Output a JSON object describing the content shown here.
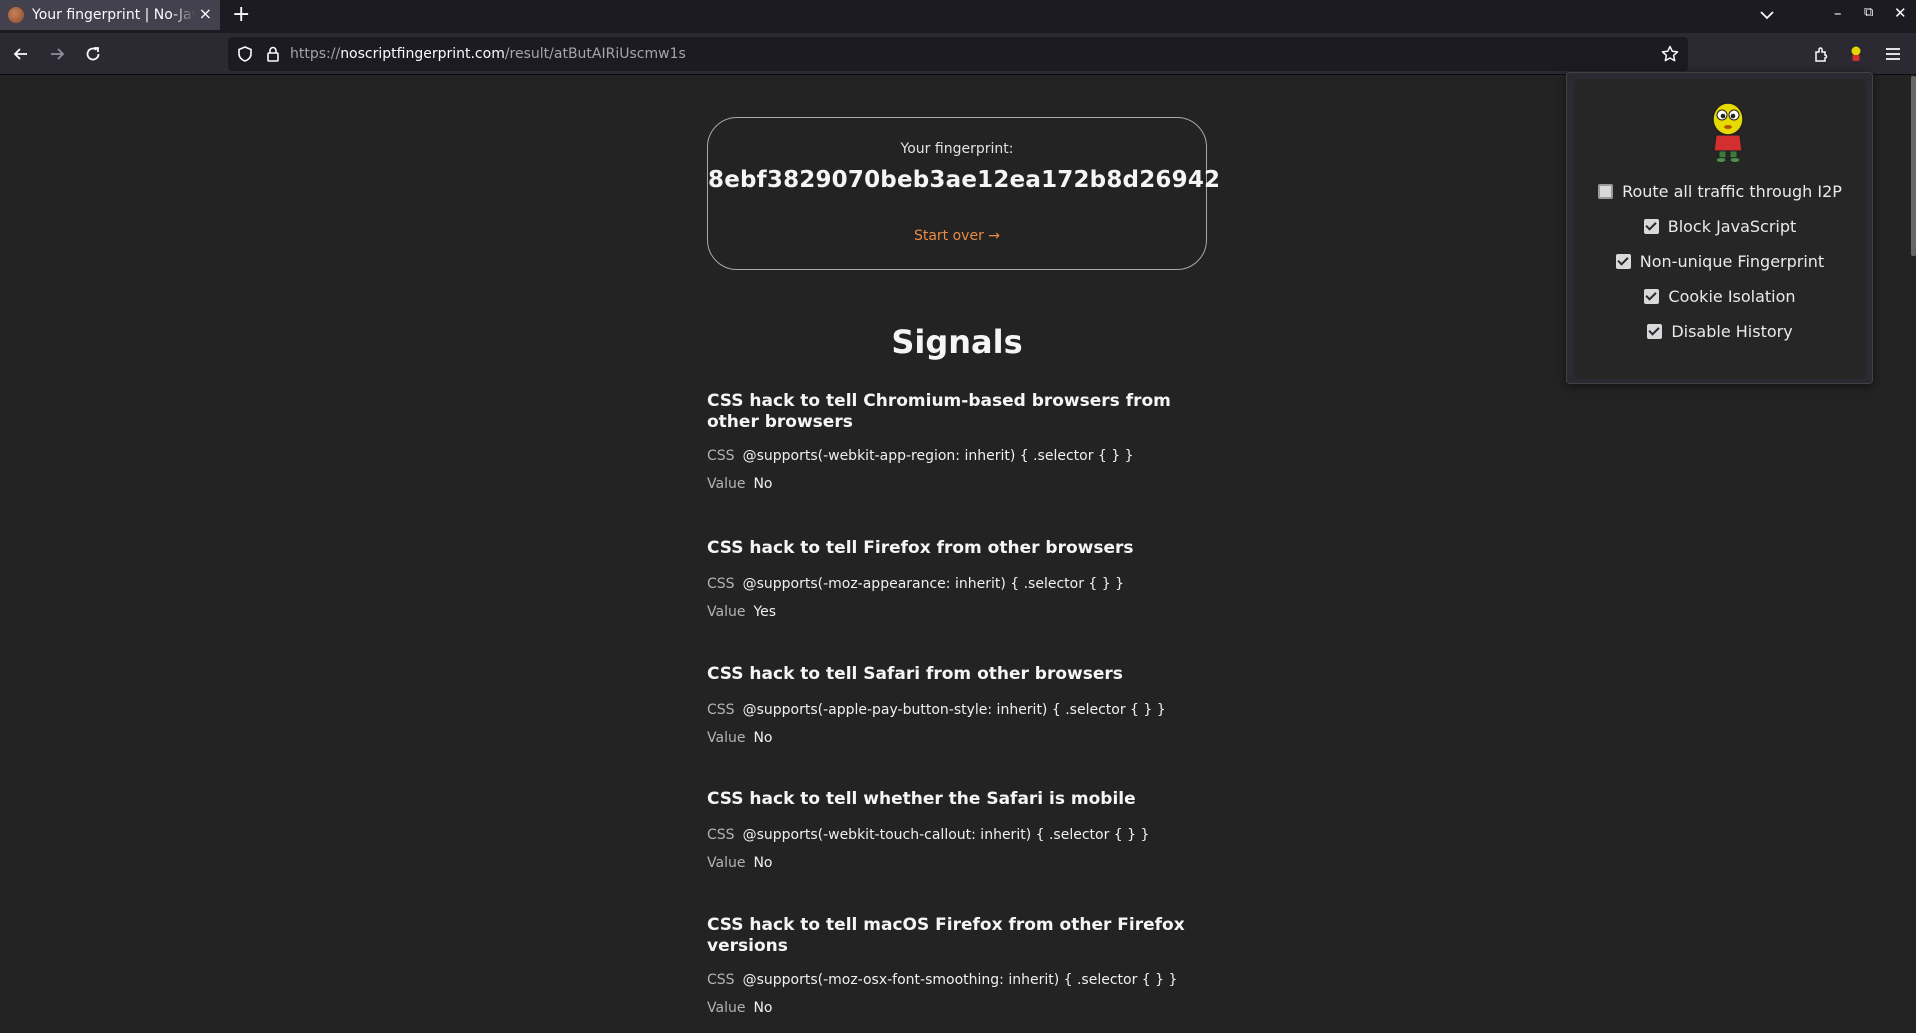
{
  "browser": {
    "tab_title": "Your fingerprint | No-JavaScript Fingerprinting",
    "tab_close": "×",
    "new_tab": "+",
    "window_controls": {
      "minimize": "–",
      "restore": "⧉",
      "close": "✕"
    },
    "url_scheme": "https://",
    "url_host": "noscriptfingerprint.com",
    "url_path": "/result/atButAIRiUscmw1s"
  },
  "page": {
    "fingerprint_label": "Your fingerprint:",
    "fingerprint_hash": "8ebf3829070beb3ae12ea172b8d26942",
    "start_over": "Start over →",
    "signals_heading": "Signals",
    "css_key": "CSS",
    "value_key": "Value",
    "signals": [
      {
        "title": "CSS hack to tell Chromium-based browsers from other browsers",
        "css": "@supports(-webkit-app-region: inherit) { .selector { } }",
        "value": "No"
      },
      {
        "title": "CSS hack to tell Firefox from other browsers",
        "css": "@supports(-moz-appearance: inherit) { .selector { } }",
        "value": "Yes"
      },
      {
        "title": "CSS hack to tell Safari from other browsers",
        "css": "@supports(-apple-pay-button-style: inherit) { .selector { } }",
        "value": "No"
      },
      {
        "title": "CSS hack to tell whether the Safari is mobile",
        "css": "@supports(-webkit-touch-callout: inherit) { .selector { } }",
        "value": "No"
      },
      {
        "title": "CSS hack to tell macOS Firefox from other Firefox versions",
        "css": "@supports(-moz-osx-font-smoothing: inherit) { .selector { } }",
        "value": "No"
      }
    ]
  },
  "extension_popup": {
    "options": [
      {
        "label": "Route all traffic through I2P",
        "checked": false
      },
      {
        "label": "Block JavaScript",
        "checked": true
      },
      {
        "label": "Non-unique Fingerprint",
        "checked": true
      },
      {
        "label": "Cookie Isolation",
        "checked": true
      },
      {
        "label": "Disable History",
        "checked": true
      }
    ]
  },
  "colors": {
    "accent_link": "#ea8a44",
    "page_bg": "#232323",
    "toolbar_bg": "#2b2a33",
    "tabstrip_bg": "#1c1b22"
  }
}
